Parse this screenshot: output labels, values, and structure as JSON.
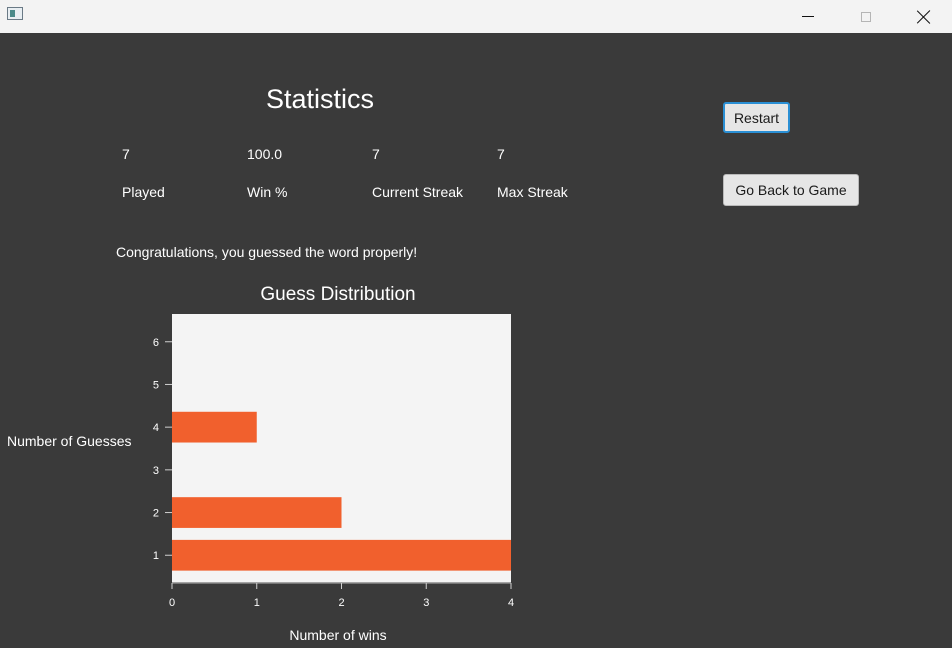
{
  "window": {
    "minimize_icon": "minimize-icon",
    "maximize_icon": "maximize-icon",
    "close_icon": "close-icon"
  },
  "stats": {
    "title": "Statistics",
    "played": {
      "value": "7",
      "label": "Played"
    },
    "win_pct": {
      "value": "100.0",
      "label": "Win %"
    },
    "current_streak": {
      "value": "7",
      "label": "Current Streak"
    },
    "max_streak": {
      "value": "7",
      "label": "Max Streak"
    },
    "message": "Congratulations, you guessed the word properly!"
  },
  "buttons": {
    "restart": "Restart",
    "back": "Go Back to Game"
  },
  "colors": {
    "background": "#3a3a3a",
    "bar": "#f1602d",
    "plot_bg": "#f4f4f4",
    "focus_border": "#2a8fd4"
  },
  "chart_data": {
    "type": "bar",
    "orientation": "horizontal",
    "title": "Guess Distribution",
    "xlabel": "Number of wins",
    "ylabel": "Number of Guesses",
    "categories": [
      "1",
      "2",
      "3",
      "4",
      "5",
      "6"
    ],
    "values": [
      4,
      2,
      0,
      1,
      0,
      0
    ],
    "xlim": [
      0,
      4
    ],
    "xticks": [
      "0",
      "1",
      "2",
      "3",
      "4"
    ],
    "grid": false
  }
}
